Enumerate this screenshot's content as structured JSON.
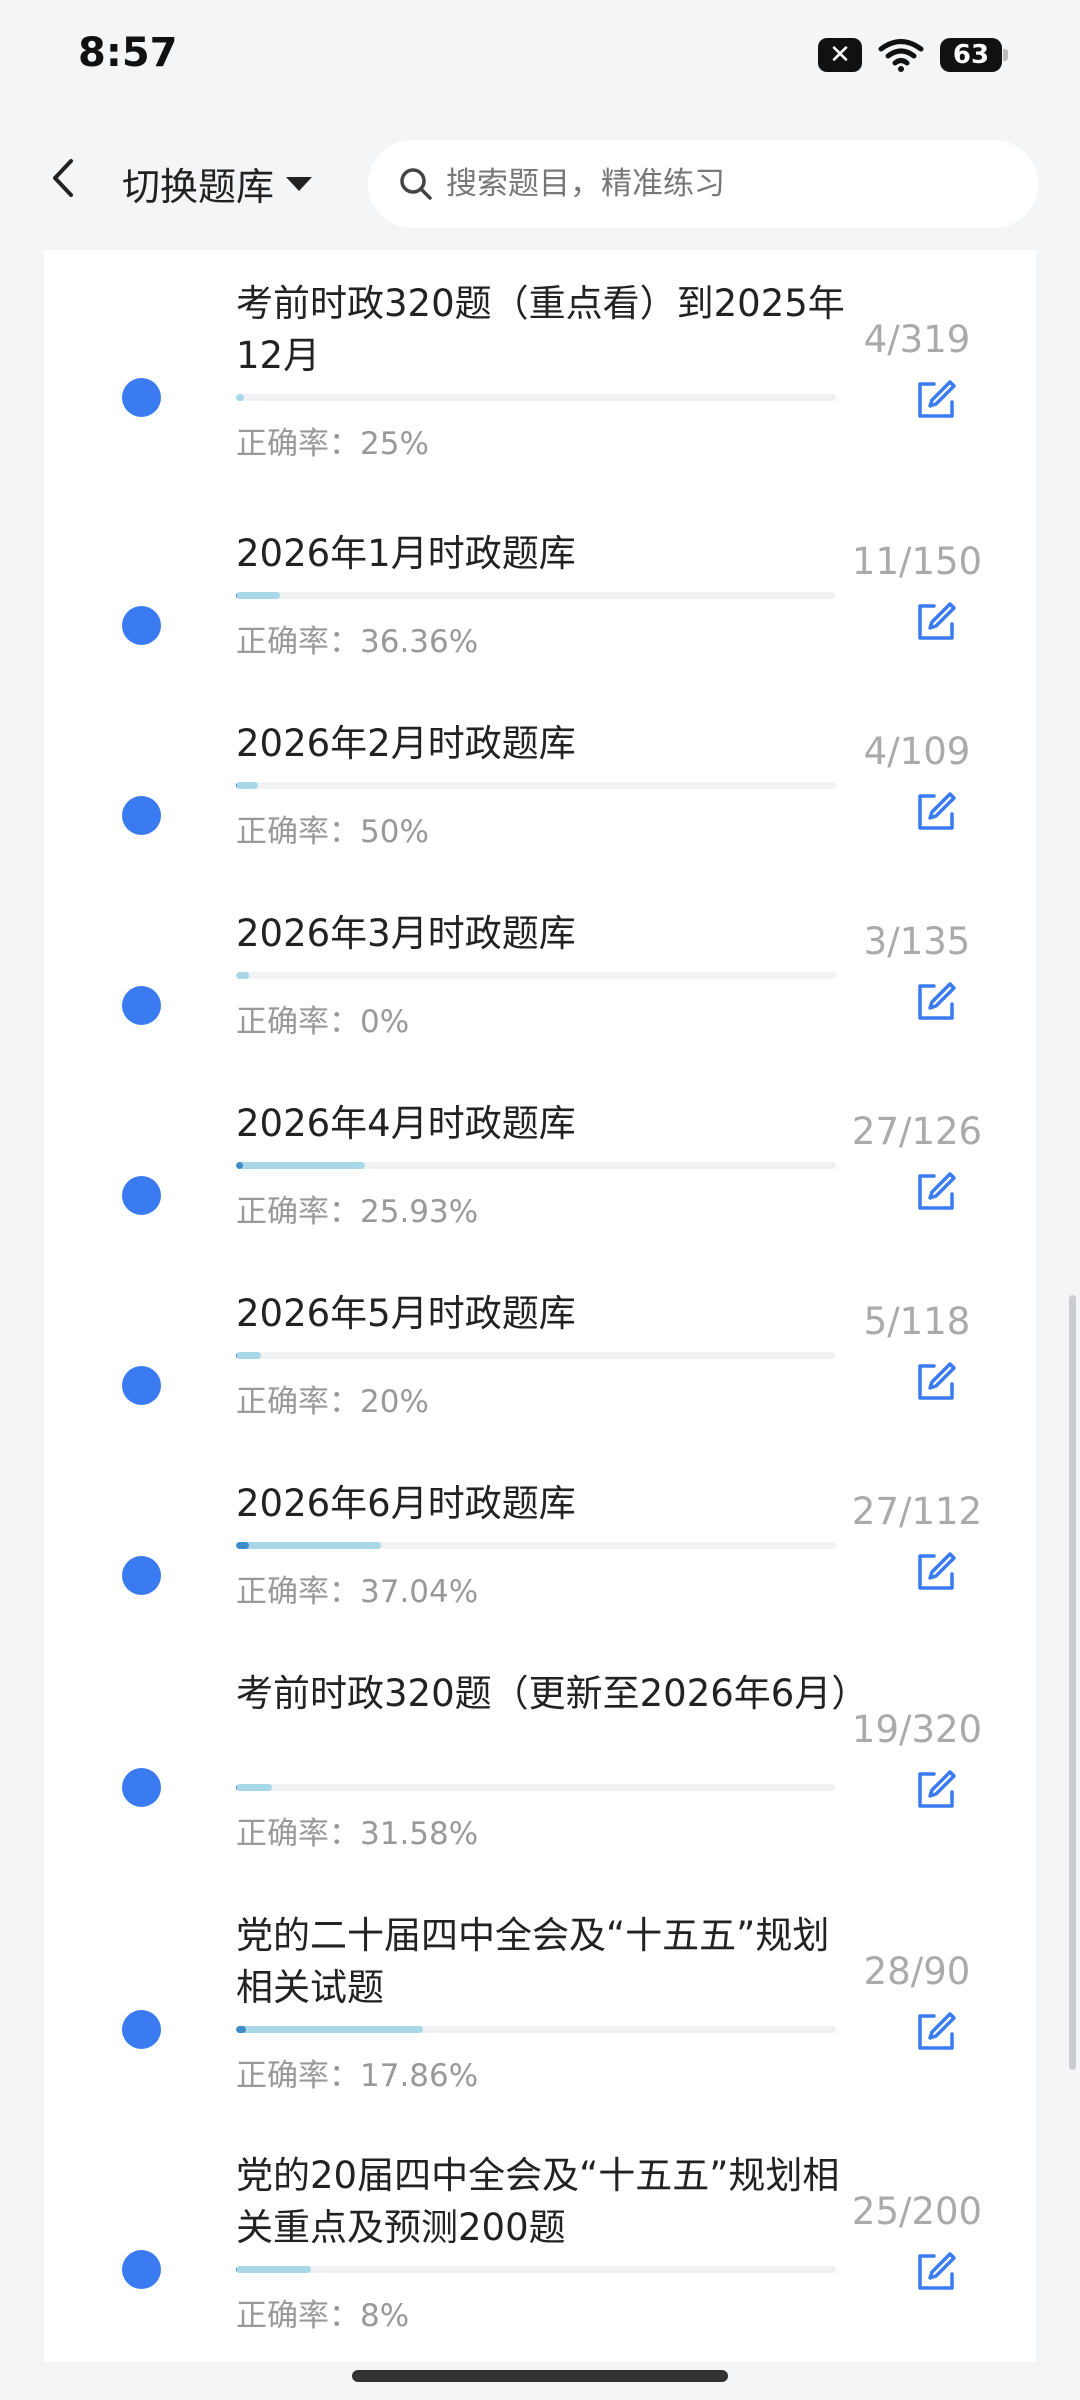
{
  "status_bar": {
    "time": "8:57",
    "battery": "63"
  },
  "header": {
    "switch_label": "切换题库",
    "search_placeholder": "搜索题目，精准练习"
  },
  "colors": {
    "accent": "#3b7bf2",
    "progress_light": "#a8d7e8",
    "progress_dark": "#3f8cc9"
  },
  "items": [
    {
      "title": "考前时政320题（重点看）到2025年12月",
      "accuracy": "正确率：25%",
      "count": "4/319",
      "progress": 0.0125,
      "correct": 0.25
    },
    {
      "title": "2026年1月时政题库",
      "accuracy": "正确率：36.36%",
      "count": "11/150",
      "progress": 0.0733,
      "correct": 0.3636
    },
    {
      "title": "2026年2月时政题库",
      "accuracy": "正确率：50%",
      "count": "4/109",
      "progress": 0.0367,
      "correct": 0.5
    },
    {
      "title": "2026年3月时政题库",
      "accuracy": "正确率：0%",
      "count": "3/135",
      "progress": 0.0222,
      "correct": 0
    },
    {
      "title": "2026年4月时政题库",
      "accuracy": "正确率：25.93%",
      "count": "27/126",
      "progress": 0.2143,
      "correct": 0.2593
    },
    {
      "title": "2026年5月时政题库",
      "accuracy": "正确率：20%",
      "count": "5/118",
      "progress": 0.0424,
      "correct": 0.2
    },
    {
      "title": "2026年6月时政题库",
      "accuracy": "正确率：37.04%",
      "count": "27/112",
      "progress": 0.2411,
      "correct": 0.3704
    },
    {
      "title": "考前时政320题（更新至2026年6月）",
      "accuracy": "正确率：31.58%",
      "count": "19/320",
      "progress": 0.0594,
      "correct": 0.3158
    },
    {
      "title": "党的二十届四中全会及“十五五”规划相关试题",
      "accuracy": "正确率：17.86%",
      "count": "28/90",
      "progress": 0.3111,
      "correct": 0.1786
    },
    {
      "title": "党的20届四中全会及“十五五”规划相关重点及预测200题",
      "accuracy": "正确率：8%",
      "count": "25/200",
      "progress": 0.125,
      "correct": 0.08
    }
  ]
}
